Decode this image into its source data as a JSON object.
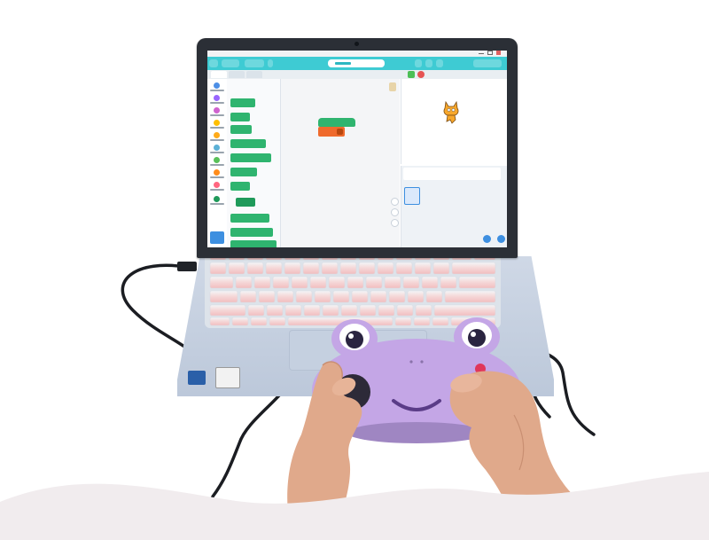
{
  "scene": "laptop-with-frog-controller",
  "colors": {
    "app_accent": "#3ecbd3",
    "motion_blocks": "#2fb46f",
    "looks_block": "#ef6a2c",
    "controller_body": "#c4a6e6",
    "controller_buttons": "#e0365a",
    "keyboard_keys_top": "#eef1f4",
    "keyboard_keys_bottom": "#f3c6c7",
    "background_wave": "#f1ecee"
  },
  "icons": [
    "scratch-sprite-icon",
    "frog-face-icon",
    "usb-plug-icon"
  ]
}
